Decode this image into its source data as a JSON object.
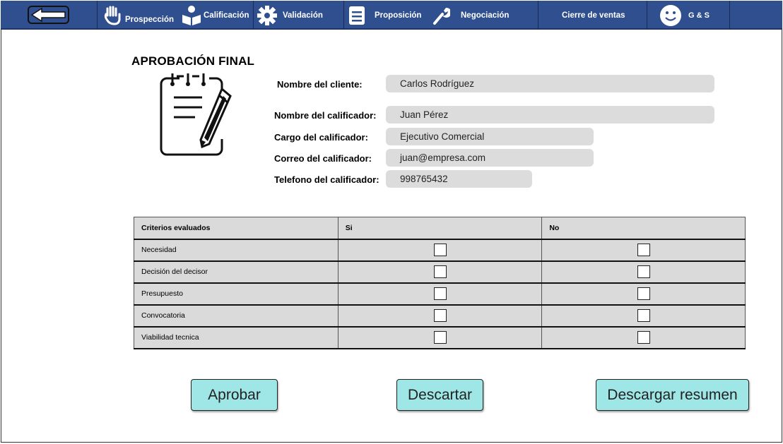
{
  "nav": {
    "prospeccion": "Prospección",
    "calificacion": "Calificación",
    "validacion": "Validación",
    "proposicion": "Proposición",
    "negociacion": "Negociación",
    "cierre": "Cierre de ventas",
    "user": "G & S"
  },
  "page_title": "APROBACIÓN FINAL",
  "fields": {
    "cliente_label": "Nombre del cliente:",
    "cliente_value": "Carlos Rodríguez",
    "calificador_label": "Nombre del calificador:",
    "calificador_value": "Juan Pérez",
    "cargo_label": "Cargo del calificador:",
    "cargo_value": "Ejecutivo Comercial",
    "correo_label": "Correo del calificador:",
    "correo_value": "juan@empresa.com",
    "telefono_label": "Telefono del calificador:",
    "telefono_value": "998765432"
  },
  "table": {
    "headers": [
      "Criterios evaluados",
      "Si",
      "No"
    ],
    "rows": [
      "Necesidad",
      "Decisión del decisor",
      "Presupuesto",
      "Convocatoria",
      "Viabilidad tecnica"
    ]
  },
  "buttons": {
    "aprobar": "Aprobar",
    "descartar": "Descartar",
    "descargar": "Descargar resumen"
  },
  "colors": {
    "navbar": "#2f4f8f",
    "button": "#9fe6e6",
    "field": "#dcdcdc",
    "table": "#dadada"
  }
}
